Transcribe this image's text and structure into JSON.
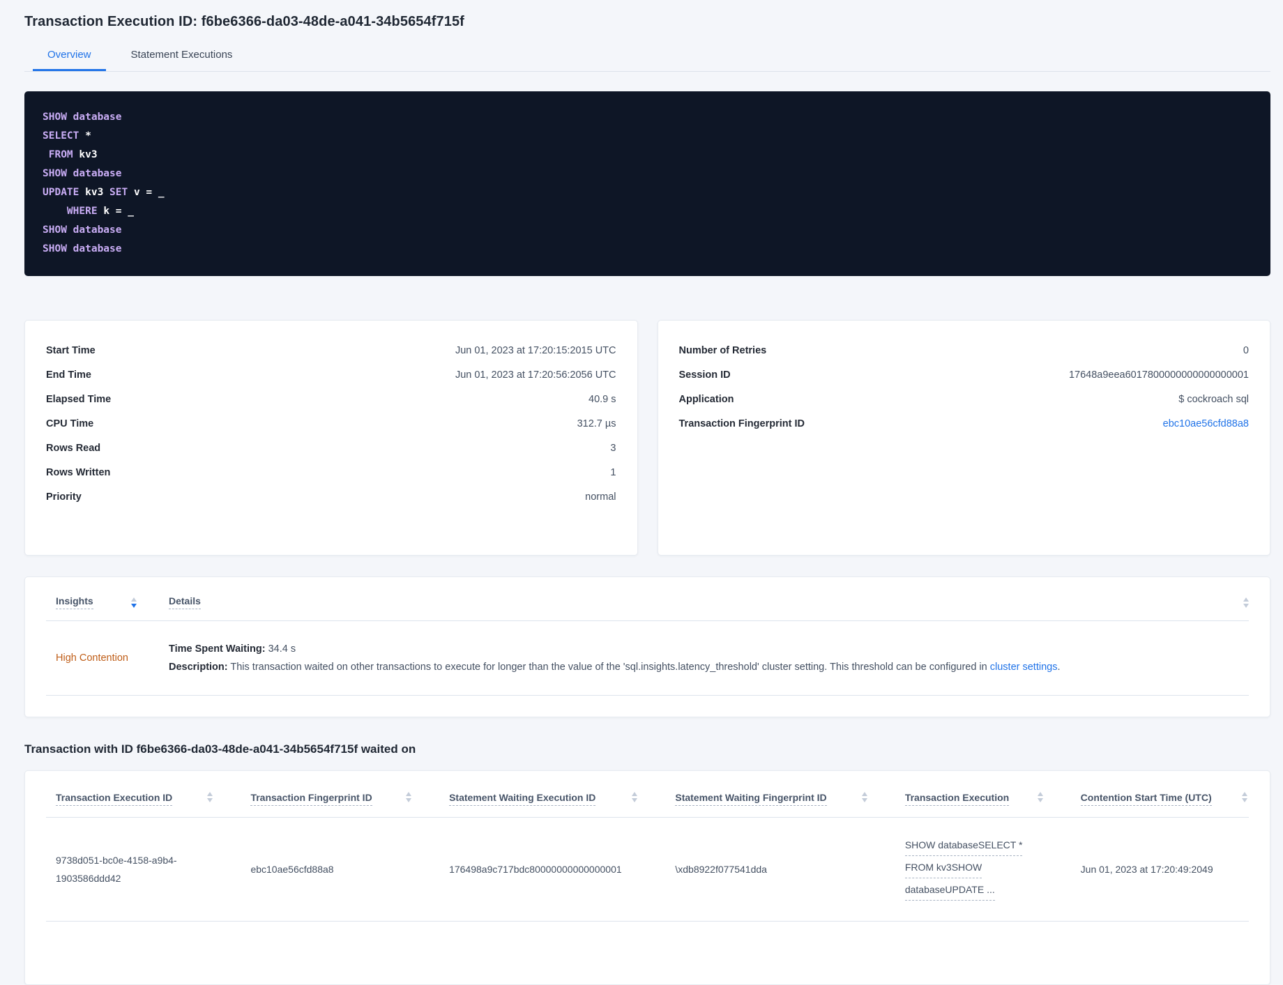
{
  "colors": {
    "accent_blue": "#2073e8",
    "warning_orange": "#bf5d17",
    "code_background": "#0e1626",
    "code_keyword": "#c9adf5",
    "code_plain": "#ffffff"
  },
  "header": {
    "title": "Transaction Execution ID: f6be6366-da03-48de-a041-34b5654f715f",
    "tabs": [
      {
        "label": "Overview",
        "active": true
      },
      {
        "label": "Statement Executions",
        "active": false
      }
    ]
  },
  "sql": {
    "lines": [
      [
        {
          "c": "kw",
          "t": "SHOW database"
        }
      ],
      [
        {
          "c": "kw",
          "t": "SELECT "
        },
        {
          "c": "pl",
          "t": "*"
        }
      ],
      [
        {
          "c": "pl",
          "t": " "
        },
        {
          "c": "kw",
          "t": "FROM "
        },
        {
          "c": "pl",
          "t": "kv3"
        }
      ],
      [
        {
          "c": "kw",
          "t": "SHOW database"
        }
      ],
      [
        {
          "c": "kw",
          "t": "UPDATE "
        },
        {
          "c": "pl",
          "t": "kv3 "
        },
        {
          "c": "kw",
          "t": "SET "
        },
        {
          "c": "pl",
          "t": "v = _"
        }
      ],
      [
        {
          "c": "pl",
          "t": "    "
        },
        {
          "c": "kw",
          "t": "WHERE "
        },
        {
          "c": "pl",
          "t": "k = _"
        }
      ],
      [
        {
          "c": "kw",
          "t": "SHOW database"
        }
      ],
      [
        {
          "c": "kw",
          "t": "SHOW database"
        }
      ]
    ]
  },
  "summary_left": {
    "rows": [
      {
        "label": "Start Time",
        "value": "Jun 01, 2023 at 17:20:15:2015 UTC"
      },
      {
        "label": "End Time",
        "value": "Jun 01, 2023 at 17:20:56:2056 UTC"
      },
      {
        "label": "Elapsed Time",
        "value": "40.9 s"
      },
      {
        "label": "CPU Time",
        "value": "312.7 µs"
      },
      {
        "label": "Rows Read",
        "value": "3"
      },
      {
        "label": "Rows Written",
        "value": "1"
      },
      {
        "label": "Priority",
        "value": "normal"
      }
    ]
  },
  "summary_right": {
    "rows": [
      {
        "label": "Number of Retries",
        "value": "0"
      },
      {
        "label": "Session ID",
        "value": "17648a9eea6017800000000000000001"
      },
      {
        "label": "Application",
        "value": "$ cockroach sql"
      },
      {
        "label": "Transaction Fingerprint ID",
        "value": "ebc10ae56cfd88a8",
        "link": true
      }
    ]
  },
  "insights": {
    "columns": [
      "Insights",
      "Details"
    ],
    "row": {
      "severity": "High Contention",
      "waiting_label": "Time Spent Waiting:",
      "waiting_value": "34.4 s",
      "description_label": "Description:",
      "description_text": "This transaction waited on other transactions to execute for longer than the value of the 'sql.insights.latency_threshold' cluster setting. This threshold can be configured in ",
      "description_link": "cluster settings",
      "description_suffix": "."
    }
  },
  "waited": {
    "heading": "Transaction with ID f6be6366-da03-48de-a041-34b5654f715f waited on",
    "columns": [
      "Transaction Execution ID",
      "Transaction Fingerprint ID",
      "Statement Waiting Execution ID",
      "Statement Waiting Fingerprint ID",
      "Transaction Execution",
      "Contention Start Time (UTC)"
    ],
    "row": {
      "transaction_execution_id": "9738d051-bc0e-4158-a9b4-1903586ddd42",
      "transaction_fingerprint_id": "ebc10ae56cfd88a8",
      "statement_waiting_execution_id": "176498a9c717bdc80000000000000001",
      "statement_waiting_fingerprint_id": "\\xdb8922f077541dda",
      "transaction_execution_lines": [
        "SHOW databaseSELECT *",
        "FROM kv3SHOW",
        "databaseUPDATE ..."
      ],
      "contention_start_time": "Jun 01, 2023 at 17:20:49:2049"
    }
  }
}
